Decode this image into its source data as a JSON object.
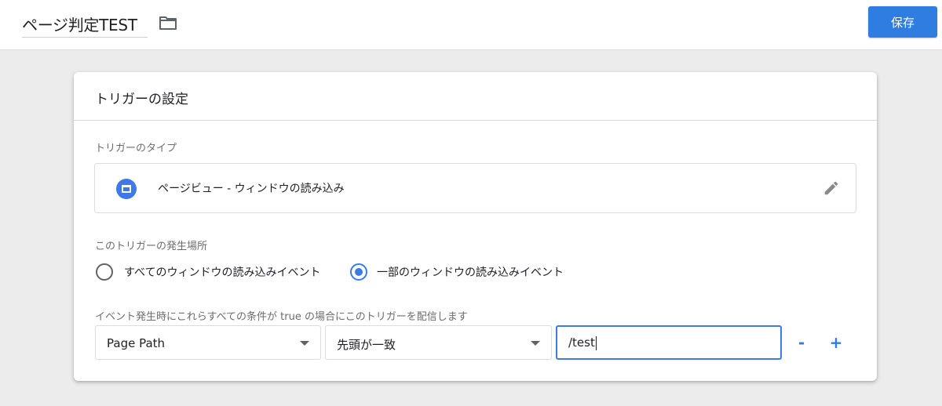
{
  "header": {
    "title": "ページ判定TEST",
    "save_label": "保存"
  },
  "card": {
    "title": "トリガーの設定",
    "trigger_type_label": "トリガーのタイプ",
    "trigger_type_value": "ページビュー - ウィンドウの読み込み",
    "fire_on_label": "このトリガーの発生場所",
    "options": [
      {
        "label": "すべてのウィンドウの読み込みイベント",
        "selected": false
      },
      {
        "label": "一部のウィンドウの読み込みイベント",
        "selected": true
      }
    ],
    "condition_label": "イベント発生時にこれらすべての条件が true の場合にこのトリガーを配信します",
    "condition": {
      "variable": "Page Path",
      "operator": "先頭が一致",
      "value": "/test"
    },
    "remove_label": "-",
    "add_label": "+"
  },
  "icons": {
    "folder": "folder-icon",
    "trigger_type": "window-icon",
    "edit": "pencil-icon"
  },
  "colors": {
    "accent": "#2f7de1",
    "icon_blue": "#3c7ae6"
  }
}
